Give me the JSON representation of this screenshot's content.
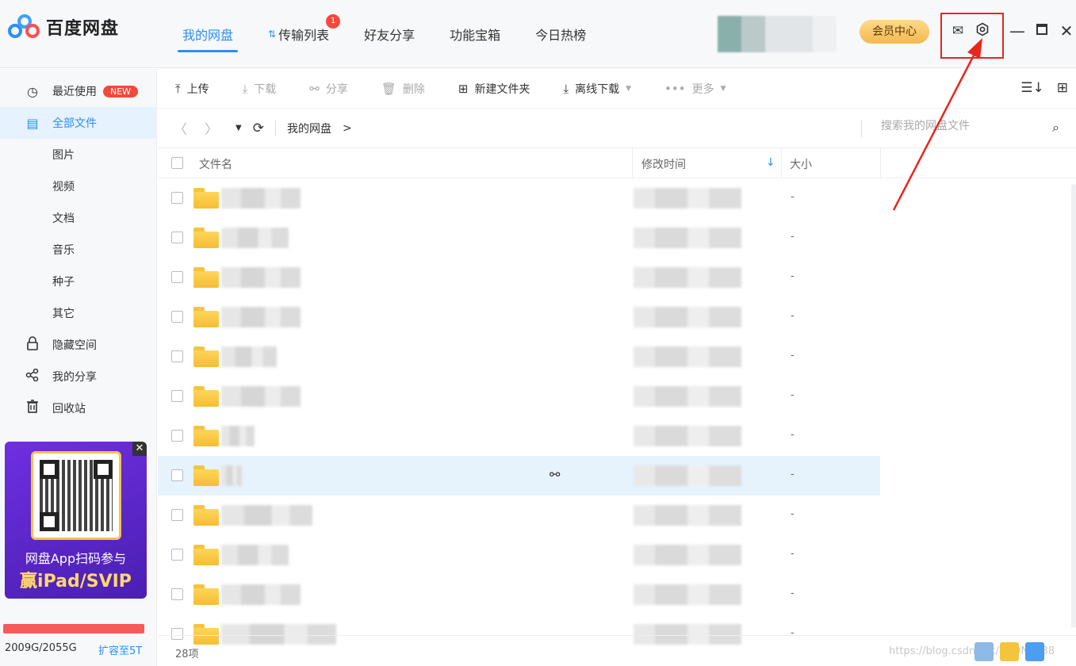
{
  "app": {
    "name": "百度网盘"
  },
  "nav": {
    "tabs": [
      {
        "label": "我的网盘",
        "active": true
      },
      {
        "label": "传输列表",
        "badge": "1"
      },
      {
        "label": "好友分享"
      },
      {
        "label": "功能宝箱"
      },
      {
        "label": "今日热榜"
      }
    ],
    "vip_label": "会员中心"
  },
  "sidebar": {
    "items": [
      {
        "label": "最近使用",
        "icon": "clock-icon",
        "badge": "NEW"
      },
      {
        "label": "全部文件",
        "icon": "file-list-icon",
        "active": true
      },
      {
        "label": "图片"
      },
      {
        "label": "视频"
      },
      {
        "label": "文档"
      },
      {
        "label": "音乐"
      },
      {
        "label": "种子"
      },
      {
        "label": "其它"
      },
      {
        "label": "隐藏空间",
        "icon": "lock-icon"
      },
      {
        "label": "我的分享",
        "icon": "share-icon"
      },
      {
        "label": "回收站",
        "icon": "trash-icon"
      }
    ],
    "promo": {
      "line1": "网盘App扫码参与",
      "line2": "赢iPad/SVIP"
    },
    "storage": {
      "text": "2009G/2055G",
      "link": "扩容至5T",
      "used_fraction": 0.978
    }
  },
  "toolbar": {
    "upload": "上传",
    "download": "下载",
    "share": "分享",
    "delete": "删除",
    "new_folder": "新建文件夹",
    "offline_download": "离线下载",
    "more": "更多"
  },
  "path": {
    "crumb": "我的网盘",
    "gt": ">",
    "search_placeholder": "搜索我的网盘文件"
  },
  "table": {
    "headers": {
      "name": "文件名",
      "time": "修改时间",
      "size": "大小"
    },
    "rows": [
      {
        "size": "-"
      },
      {
        "size": "-"
      },
      {
        "size": "-"
      },
      {
        "size": "-"
      },
      {
        "size": "-"
      },
      {
        "size": "-"
      },
      {
        "size": "-"
      },
      {
        "size": "-"
      },
      {
        "size": "-"
      },
      {
        "size": "-"
      },
      {
        "size": "-"
      },
      {
        "size": "-"
      }
    ]
  },
  "status": {
    "count": "28项",
    "watermark": "https://blog.csdn.net/CSDN9038"
  },
  "colors": {
    "accent": "#2a8ff7",
    "highlight": "#e8261c",
    "badge": "#f5483b"
  }
}
